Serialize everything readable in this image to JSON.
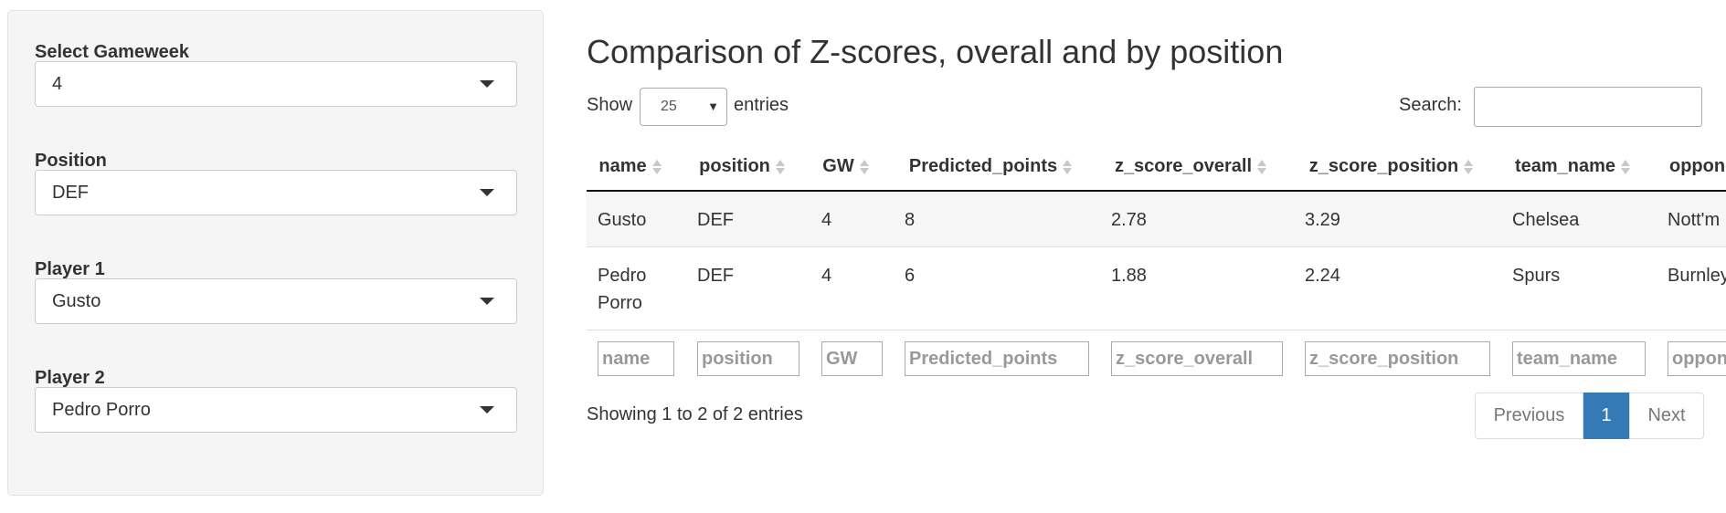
{
  "sidebar": {
    "gameweek": {
      "label": "Select Gameweek",
      "value": "4"
    },
    "position": {
      "label": "Position",
      "value": "DEF"
    },
    "player1": {
      "label": "Player 1",
      "value": "Gusto"
    },
    "player2": {
      "label": "Player 2",
      "value": "Pedro Porro"
    }
  },
  "main": {
    "title": "Comparison of Z-scores, overall and by position",
    "show_label": "Show",
    "length_value": "25",
    "entries_label": "entries",
    "search_label": "Search:",
    "columns": [
      "name",
      "position",
      "GW",
      "Predicted_points",
      "z_score_overall",
      "z_score_position",
      "team_name",
      "opponent"
    ],
    "rows": [
      [
        "Gusto",
        "DEF",
        "4",
        "8",
        "2.78",
        "3.29",
        "Chelsea",
        "Nott'm Forest"
      ],
      [
        "Pedro Porro",
        "DEF",
        "4",
        "6",
        "1.88",
        "2.24",
        "Spurs",
        "Burnley"
      ]
    ],
    "filter_placeholders": [
      "name",
      "position",
      "GW",
      "Predicted_points",
      "z_score_overall",
      "z_score_position",
      "team_name",
      "opponent"
    ],
    "info": "Showing 1 to 2 of 2 entries",
    "pager": {
      "previous": "Previous",
      "current": "1",
      "next": "Next"
    }
  },
  "colors": {
    "accent": "#337ab7",
    "sidebar_bg": "#f5f5f5",
    "stripe": "#f6f6f6"
  }
}
